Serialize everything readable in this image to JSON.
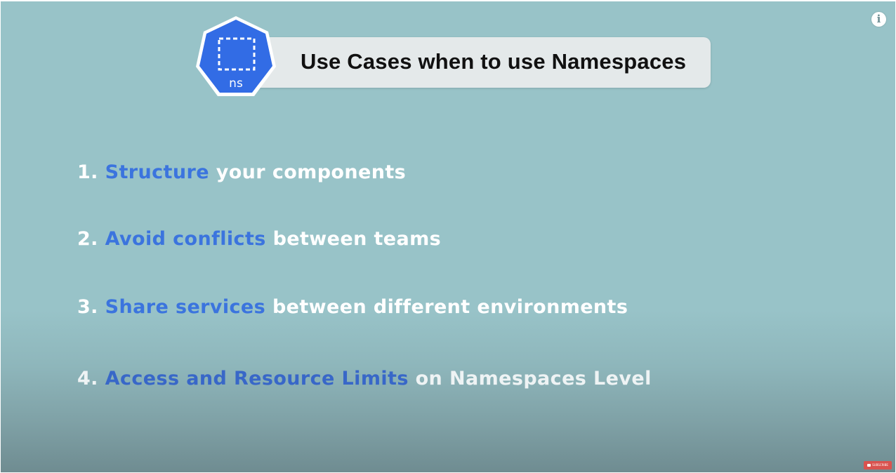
{
  "header": {
    "badge_label": "ns",
    "title": "Use Cases when to use Namespaces"
  },
  "use_cases": [
    {
      "number": "1.",
      "highlight": "Structure",
      "rest": "your components"
    },
    {
      "number": "2.",
      "highlight": "Avoid conflicts",
      "rest": "between teams"
    },
    {
      "number": "3.",
      "highlight": "Share services",
      "rest": "between different environments"
    },
    {
      "number": "4.",
      "highlight": "Access and Resource Limits",
      "rest": "on Namespaces Level"
    }
  ],
  "overlay": {
    "info_icon": "info-icon",
    "info_glyph": "i",
    "subscribe_label": "SUBSCRIBE"
  },
  "colors": {
    "background": "#98c3c8",
    "highlight": "#3b74de",
    "badge": "#326ce5",
    "title_pill": "#e4e9ea"
  }
}
